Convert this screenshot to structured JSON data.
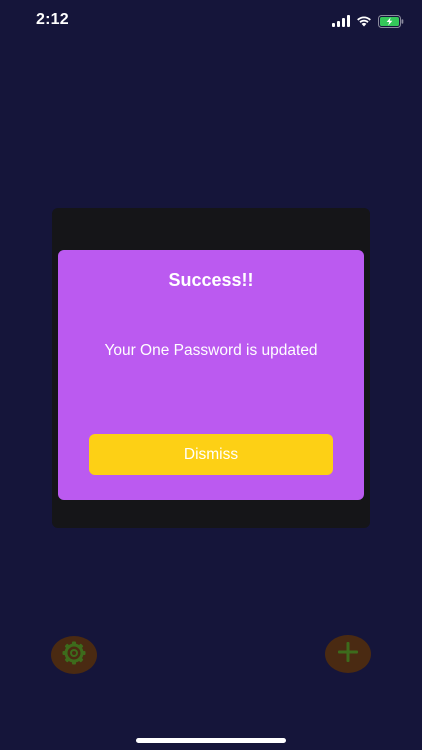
{
  "status_bar": {
    "time": "2:12",
    "icons": [
      "cellular-signal-icon",
      "wifi-icon",
      "battery-charging-icon"
    ]
  },
  "modal": {
    "title": "Success!!",
    "message": "Your One Password is updated",
    "dismiss_label": "Dismiss"
  },
  "bottom_bar": {
    "settings_icon": "gear-icon",
    "add_icon": "plus-icon"
  },
  "colors": {
    "background": "#15153a",
    "frame": "#151518",
    "modal": "#bb5af0",
    "button": "#fdd015",
    "fab": "#4a2a12",
    "fab_icon": "#3d6b1c",
    "battery_green": "#34c759"
  }
}
